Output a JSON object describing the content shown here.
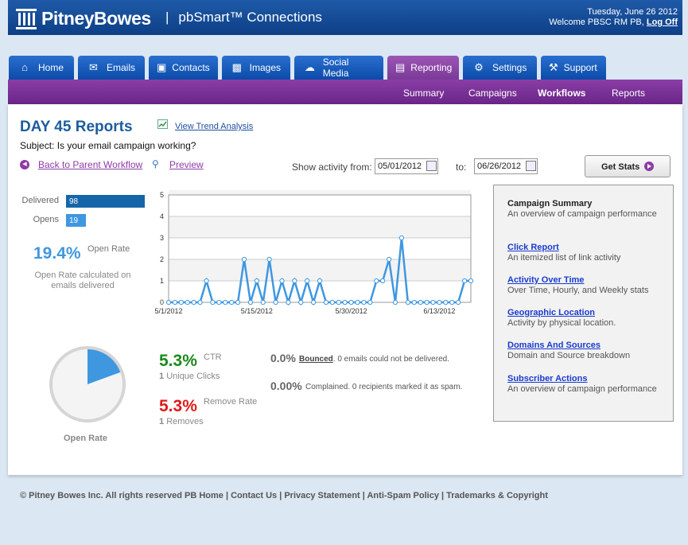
{
  "header": {
    "brand": "PitneyBowes",
    "product_sep": "|",
    "product": "pbSmart™ Connections",
    "date": "Tuesday, June 26 2012",
    "welcome": "Welcome PBSC RM PB,",
    "logoff": "Log Off"
  },
  "tabs": [
    {
      "label": "Home",
      "icon": "house-icon",
      "active": false
    },
    {
      "label": "Emails",
      "icon": "envelope-icon",
      "active": false
    },
    {
      "label": "Contacts",
      "icon": "box-icon",
      "active": false
    },
    {
      "label": "Images",
      "icon": "film-icon",
      "active": false
    },
    {
      "label": "Social Media",
      "icon": "speech-bubbles-icon",
      "active": false
    },
    {
      "label": "Reporting",
      "icon": "report-icon",
      "active": true
    },
    {
      "label": "Settings",
      "icon": "gear-icon",
      "active": false
    },
    {
      "label": "Support",
      "icon": "wrench-icon",
      "active": false
    }
  ],
  "subnav": {
    "summary": "Summary",
    "campaigns": "Campaigns",
    "workflows": "Workflows",
    "reports": "Reports",
    "active": "Workflows"
  },
  "page": {
    "title": "DAY 45 Reports",
    "trend_link": "View Trend Analysis",
    "subject": "Subject: Is your email campaign working?",
    "back_link": "Back to Parent Workflow",
    "preview_link": "Preview",
    "show_from_label": "Show activity from:",
    "from_date": "05/01/2012",
    "to_label": "to:",
    "to_date": "06/26/2012",
    "get_stats": "Get Stats"
  },
  "stats": {
    "delivered_label": "Delivered",
    "delivered_value": "98",
    "opens_label": "Opens",
    "opens_value": "19",
    "open_rate": "19.4%",
    "open_rate_label": "Open Rate",
    "open_rate_note": "Open Rate calculated on emails delivered",
    "open_rate_fraction": 0.194,
    "pie_label": "Open Rate",
    "ctr": "5.3%",
    "ctr_label": "CTR",
    "unique_clicks_count": "1",
    "unique_clicks_label": "Unique Clicks",
    "remove_rate": "5.3%",
    "remove_rate_label": "Remove Rate",
    "removes_count": "1",
    "removes_label": "Removes",
    "bounced_pct": "0.0%",
    "bounced_label": "Bounced",
    "bounced_note": ". 0 emails could not be delivered.",
    "complained_pct": "0.00%",
    "complained_note": "Complained. 0  recipients marked it as spam."
  },
  "colors": {
    "accent_blue": "#3f97e0",
    "delivered_bar": "#1566a8",
    "opens_bar": "#3f97e0",
    "ctr_green": "#1a8a1a",
    "remove_red": "#e01b1b",
    "purple": "#8e3aa8"
  },
  "chart_data": {
    "type": "line",
    "x_start": "5/1/2012",
    "x_ticks": [
      "5/1/2012",
      "5/15/2012",
      "5/30/2012",
      "6/13/2012"
    ],
    "ylim": [
      0,
      5
    ],
    "y_ticks": [
      0,
      1,
      2,
      3,
      4,
      5
    ],
    "grid": true,
    "values": [
      0,
      0,
      0,
      0,
      0,
      0,
      1,
      0,
      0,
      0,
      0,
      0,
      2,
      0,
      1,
      0,
      2,
      0,
      1,
      0,
      1,
      0,
      1,
      0,
      1,
      0,
      0,
      0,
      0,
      0,
      0,
      0,
      0,
      1,
      1,
      2,
      0,
      3,
      0,
      0,
      0,
      0,
      0,
      0,
      0,
      0,
      0,
      1,
      1
    ]
  },
  "side": {
    "title": "Campaign Summary",
    "title_desc": "An overview of campaign performance",
    "links": [
      {
        "label": "Click Report",
        "desc": "An itemized list of link activity"
      },
      {
        "label": "Activity Over Time",
        "desc": "Over Time, Hourly, and Weekly stats"
      },
      {
        "label": "Geographic Location",
        "desc": "Activity by physical location."
      },
      {
        "label": "Domains And Sources",
        "desc": "Domain and Source breakdown"
      },
      {
        "label": "Subscriber Actions",
        "desc": "An overview of campaign performance"
      }
    ]
  },
  "footer": "© Pitney Bowes Inc. All rights reserved PB Home | Contact Us | Privacy Statement | Anti-Spam Policy | Trademarks & Copyright"
}
